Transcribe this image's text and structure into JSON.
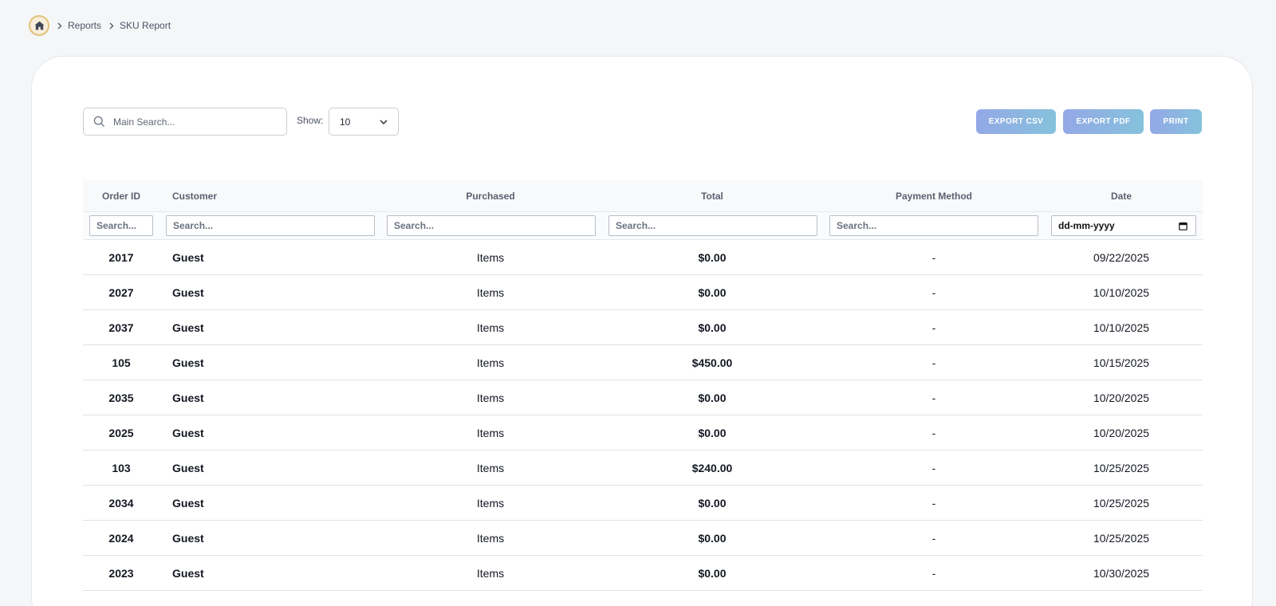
{
  "breadcrumb": {
    "items": [
      "Reports",
      "SKU Report"
    ]
  },
  "toolbar": {
    "search_placeholder": "Main Search...",
    "show_label": "Show:",
    "show_value": "10",
    "export_csv": "EXPORT CSV",
    "export_pdf": "EXPORT PDF",
    "print": "PRINT"
  },
  "table": {
    "columns": [
      "Order ID",
      "Customer",
      "Purchased",
      "Total",
      "Payment Method",
      "Date"
    ],
    "filter_placeholder": "Search...",
    "date_placeholder": "dd-mm-yyyy",
    "rows": [
      {
        "id": "2017",
        "customer": "Guest",
        "purchased": "Items",
        "total": "$0.00",
        "payment": "-",
        "date": "09/22/2025"
      },
      {
        "id": "2027",
        "customer": "Guest",
        "purchased": "Items",
        "total": "$0.00",
        "payment": "-",
        "date": "10/10/2025"
      },
      {
        "id": "2037",
        "customer": "Guest",
        "purchased": "Items",
        "total": "$0.00",
        "payment": "-",
        "date": "10/10/2025"
      },
      {
        "id": "105",
        "customer": "Guest",
        "purchased": "Items",
        "total": "$450.00",
        "payment": "-",
        "date": "10/15/2025"
      },
      {
        "id": "2035",
        "customer": "Guest",
        "purchased": "Items",
        "total": "$0.00",
        "payment": "-",
        "date": "10/20/2025"
      },
      {
        "id": "2025",
        "customer": "Guest",
        "purchased": "Items",
        "total": "$0.00",
        "payment": "-",
        "date": "10/20/2025"
      },
      {
        "id": "103",
        "customer": "Guest",
        "purchased": "Items",
        "total": "$240.00",
        "payment": "-",
        "date": "10/25/2025"
      },
      {
        "id": "2034",
        "customer": "Guest",
        "purchased": "Items",
        "total": "$0.00",
        "payment": "-",
        "date": "10/25/2025"
      },
      {
        "id": "2024",
        "customer": "Guest",
        "purchased": "Items",
        "total": "$0.00",
        "payment": "-",
        "date": "10/25/2025"
      },
      {
        "id": "2023",
        "customer": "Guest",
        "purchased": "Items",
        "total": "$0.00",
        "payment": "-",
        "date": "10/30/2025"
      }
    ]
  },
  "colors": {
    "accent_gradient_start": "#93a8e6",
    "accent_gradient_end": "#86c2dc",
    "home_ring": "#e2c27a"
  }
}
